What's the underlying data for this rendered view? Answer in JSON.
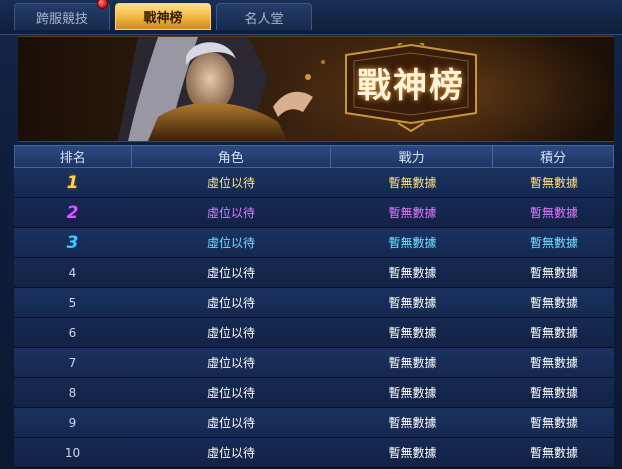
{
  "tabs": [
    {
      "label": "跨服競技"
    },
    {
      "label": "戰神榜"
    },
    {
      "label": "名人堂"
    }
  ],
  "banner": {
    "title": "戰神榜"
  },
  "table": {
    "headers": [
      "排名",
      "角色",
      "戰力",
      "積分"
    ],
    "rows": [
      {
        "rank": "1",
        "role": "虛位以待",
        "power": "暫無數據",
        "score": "暫無數據"
      },
      {
        "rank": "2",
        "role": "虛位以待",
        "power": "暫無數據",
        "score": "暫無數據"
      },
      {
        "rank": "3",
        "role": "虛位以待",
        "power": "暫無數據",
        "score": "暫無數據"
      },
      {
        "rank": "4",
        "role": "虛位以待",
        "power": "暫無數據",
        "score": "暫無數據"
      },
      {
        "rank": "5",
        "role": "虛位以待",
        "power": "暫無數據",
        "score": "暫無數據"
      },
      {
        "rank": "6",
        "role": "虛位以待",
        "power": "暫無數據",
        "score": "暫無數據"
      },
      {
        "rank": "7",
        "role": "虛位以待",
        "power": "暫無數據",
        "score": "暫無數據"
      },
      {
        "rank": "8",
        "role": "虛位以待",
        "power": "暫無數據",
        "score": "暫無數據"
      },
      {
        "rank": "9",
        "role": "虛位以待",
        "power": "暫無數據",
        "score": "暫無數據"
      },
      {
        "rank": "10",
        "role": "虛位以待",
        "power": "暫無數據",
        "score": "暫無數據"
      }
    ]
  },
  "colors": {
    "gold": "#ffd24a",
    "purple": "#d25bff",
    "cyan": "#42c6ff",
    "active_tab": "#f0b640"
  }
}
